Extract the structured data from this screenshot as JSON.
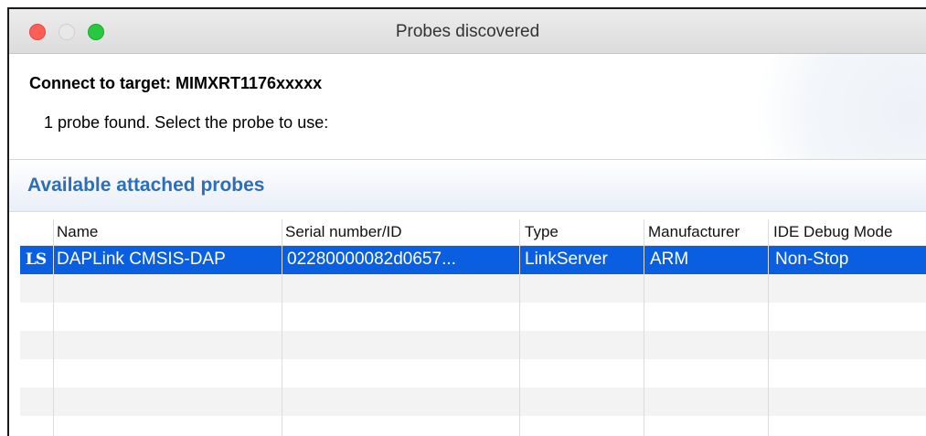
{
  "window": {
    "title": "Probes discovered"
  },
  "header": {
    "connect_title": "Connect to target: MIMXRT1176xxxxx",
    "message": "1 probe found. Select the probe to use:"
  },
  "section": {
    "title": "Available attached probes"
  },
  "table": {
    "columns": [
      "Name",
      "Serial number/ID",
      "Type",
      "Manufacturer",
      "IDE Debug Mode"
    ],
    "rows": [
      {
        "icon": "LS",
        "name": "DAPLink CMSIS-DAP",
        "serial": "02280000082d0657...",
        "type": "LinkServer",
        "manufacturer": "ARM",
        "mode": "Non-Stop",
        "selected": true
      }
    ]
  },
  "colors": {
    "selection": "#0a5ee0",
    "section_title": "#2d6fb6"
  }
}
